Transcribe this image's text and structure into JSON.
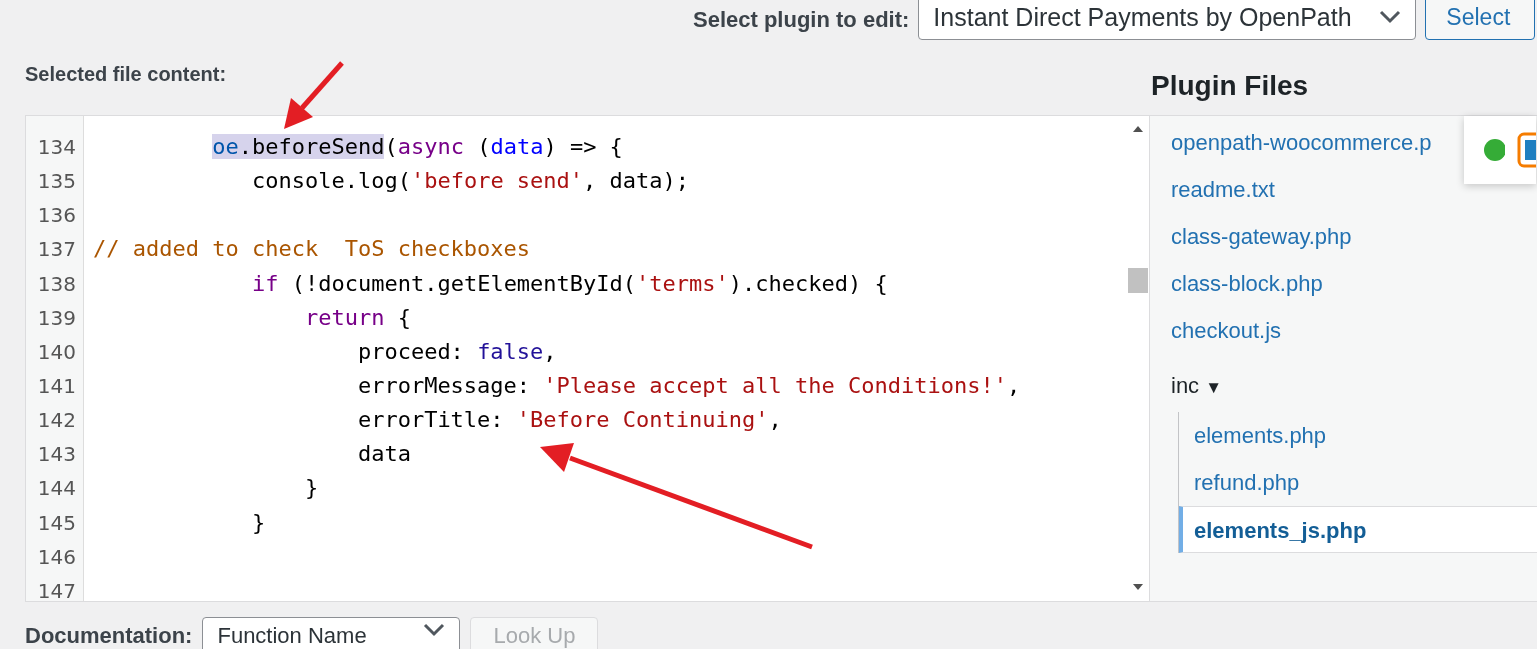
{
  "header": {
    "plugin_label": "Select plugin to edit:",
    "plugin_select": "Instant Direct Payments by OpenPath",
    "select_button": "Select"
  },
  "editor": {
    "label": "Selected file content:",
    "lines": [
      {
        "number": "134",
        "tokens": [
          {
            "text": "         oe",
            "kind": "variable",
            "highlighted": true
          },
          {
            "text": ".beforeSend",
            "kind": "plain",
            "highlighted": true
          },
          {
            "text": "(",
            "kind": "plain",
            "highlighted": false
          },
          {
            "text": "async",
            "kind": "keyword",
            "highlighted": false
          },
          {
            "text": " (",
            "kind": "plain",
            "highlighted": false
          },
          {
            "text": "data",
            "kind": "def",
            "highlighted": false
          },
          {
            "text": ") => {",
            "kind": "plain",
            "highlighted": false
          }
        ]
      },
      {
        "number": "135",
        "tokens": [
          {
            "text": "            console.log(",
            "kind": "plain",
            "highlighted": false
          },
          {
            "text": "'before send'",
            "kind": "string",
            "highlighted": false
          },
          {
            "text": ", data);",
            "kind": "plain",
            "highlighted": false
          }
        ]
      },
      {
        "number": "136"
      },
      {
        "number": "137",
        "tokens": [
          {
            "text": "// added to check  ToS checkboxes",
            "kind": "comment",
            "highlighted": false
          }
        ]
      },
      {
        "number": "138",
        "tokens": [
          {
            "text": "            if",
            "kind": "keyword",
            "highlighted": false
          },
          {
            "text": " (!document.getElementById(",
            "kind": "plain",
            "highlighted": false
          },
          {
            "text": "'terms'",
            "kind": "string",
            "highlighted": false
          },
          {
            "text": ").checked) {",
            "kind": "plain",
            "highlighted": false
          }
        ]
      },
      {
        "number": "139",
        "tokens": [
          {
            "text": "                return",
            "kind": "keyword",
            "highlighted": false
          },
          {
            "text": " {",
            "kind": "plain",
            "highlighted": false
          }
        ]
      },
      {
        "number": "140",
        "tokens": [
          {
            "text": "                    proceed: ",
            "kind": "plain",
            "highlighted": false
          },
          {
            "text": "false",
            "kind": "atom",
            "highlighted": false
          },
          {
            "text": ",",
            "kind": "plain",
            "highlighted": false
          }
        ]
      },
      {
        "number": "141",
        "tokens": [
          {
            "text": "                    errorMessage: ",
            "kind": "plain",
            "highlighted": false
          },
          {
            "text": "'Please accept all the Conditions!'",
            "kind": "string",
            "highlighted": false
          },
          {
            "text": ",",
            "kind": "plain",
            "highlighted": false
          }
        ]
      },
      {
        "number": "142",
        "tokens": [
          {
            "text": "                    errorTitle: ",
            "kind": "plain",
            "highlighted": false
          },
          {
            "text": "'Before Continuing'",
            "kind": "string",
            "highlighted": false
          },
          {
            "text": ",",
            "kind": "plain",
            "highlighted": false
          }
        ]
      },
      {
        "number": "143",
        "tokens": [
          {
            "text": "                    data",
            "kind": "plain",
            "highlighted": false
          }
        ]
      },
      {
        "number": "144",
        "tokens": [
          {
            "text": "                }",
            "kind": "plain",
            "highlighted": false
          }
        ]
      },
      {
        "number": "145",
        "tokens": [
          {
            "text": "            }",
            "kind": "plain",
            "highlighted": false
          }
        ]
      },
      {
        "number": "146"
      },
      {
        "number": "147"
      }
    ]
  },
  "plugin_files": {
    "title": "Plugin Files",
    "items": [
      {
        "kind": "file",
        "name": "openpath-woocommerce.p",
        "selected": false
      },
      {
        "kind": "file",
        "name": "readme.txt",
        "selected": false
      },
      {
        "kind": "file",
        "name": "class-gateway.php",
        "selected": false
      },
      {
        "kind": "file",
        "name": "class-block.php",
        "selected": false
      },
      {
        "kind": "file",
        "name": "checkout.js",
        "selected": false
      },
      {
        "kind": "folder",
        "name": "inc",
        "toggle": "▼",
        "expanded": true,
        "children": [
          {
            "kind": "file",
            "name": "elements.php",
            "selected": false
          },
          {
            "kind": "file",
            "name": "refund.php",
            "selected": false
          },
          {
            "kind": "file",
            "name": "elements_js.php",
            "selected": true
          }
        ]
      }
    ]
  },
  "documentation": {
    "label": "Documentation:",
    "select": "Function Name",
    "button": "Look Up",
    "disabled": true
  }
}
